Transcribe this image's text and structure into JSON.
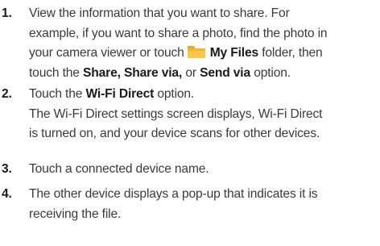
{
  "steps": [
    {
      "number": "1.",
      "line1": "View the information that you want to share. For",
      "line2": "example, if you want to share a photo, find the photo in",
      "line3_pre": "your camera viewer or touch",
      "line3_icon": "folder-icon",
      "line3_bold": "My Files",
      "line3_post": " folder, then",
      "line4_pre": "touch the ",
      "line4_bold1": "Share, Share via,",
      "line4_mid": " or ",
      "line4_bold2": "Send via",
      "line4_post": " option."
    },
    {
      "number": "2.",
      "line1_pre": "Touch the ",
      "line1_bold": "Wi-Fi Direct",
      "line1_post": " option.",
      "line2": "The Wi-Fi Direct settings screen displays, Wi-Fi Direct",
      "line3": "is turned on, and your device scans for other devices."
    },
    {
      "number": "3.",
      "line1": "Touch a connected device name."
    },
    {
      "number": "4.",
      "line1": "The other device displays a pop-up that indicates it is",
      "line2": "receiving the file."
    }
  ],
  "colors": {
    "text": "#3a3a3a",
    "bold_text": "#1a1a1a",
    "folder": "#f7b52a"
  }
}
